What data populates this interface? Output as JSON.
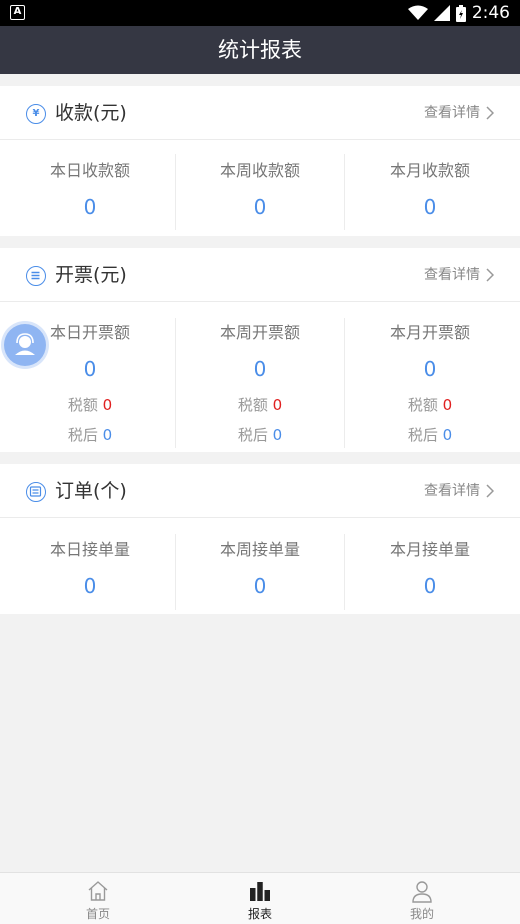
{
  "status_bar": {
    "time": "2:46",
    "app_icon_letter": "A"
  },
  "header": {
    "title": "统计报表"
  },
  "sections": {
    "receipts": {
      "title": "收款(元)",
      "detail_link": "查看详情",
      "icon_glyph": "¥",
      "stats": [
        {
          "label": "本日收款额",
          "value": "0"
        },
        {
          "label": "本周收款额",
          "value": "0"
        },
        {
          "label": "本月收款额",
          "value": "0"
        }
      ]
    },
    "invoices": {
      "title": "开票(元)",
      "detail_link": "查看详情",
      "stats": [
        {
          "label": "本日开票额",
          "value": "0",
          "tax_label": "税额",
          "tax_value": "0",
          "after_tax_label": "税后",
          "after_tax_value": "0"
        },
        {
          "label": "本周开票额",
          "value": "0",
          "tax_label": "税额",
          "tax_value": "0",
          "after_tax_label": "税后",
          "after_tax_value": "0"
        },
        {
          "label": "本月开票额",
          "value": "0",
          "tax_label": "税额",
          "tax_value": "0",
          "after_tax_label": "税后",
          "after_tax_value": "0"
        }
      ]
    },
    "orders": {
      "title": "订单(个)",
      "detail_link": "查看详情",
      "stats": [
        {
          "label": "本日接单量",
          "value": "0"
        },
        {
          "label": "本周接单量",
          "value": "0"
        },
        {
          "label": "本月接单量",
          "value": "0"
        }
      ]
    }
  },
  "tab_bar": {
    "tabs": [
      {
        "label": "首页",
        "icon": "home-icon",
        "active": false
      },
      {
        "label": "报表",
        "icon": "bar-chart-icon",
        "active": true
      },
      {
        "label": "我的",
        "icon": "user-icon",
        "active": false
      }
    ]
  },
  "colors": {
    "accent": "#4a8de8",
    "title_bar": "#353743",
    "tax_red": "#e02020",
    "background": "#f2f2f2"
  }
}
